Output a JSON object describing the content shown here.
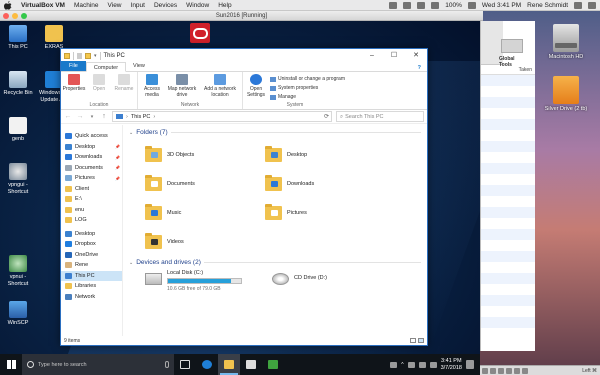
{
  "mac_menubar": {
    "app": "VirtualBox VM",
    "items": [
      "Machine",
      "View",
      "Input",
      "Devices",
      "Window",
      "Help"
    ],
    "battery": "100%",
    "clock": "Wed 3:41 PM",
    "user": "Rene Schmidt"
  },
  "vbox": {
    "window_title": "Sun2016 [Running]",
    "hostkey": "Left ⌘"
  },
  "mac_icons": [
    "Macintosh HD",
    "Silver Drive (2 tb)"
  ],
  "finder": {
    "toolbar_label": "Global Tools",
    "column_header": "Taken"
  },
  "desktop_icons": [
    "This PC",
    "EXRAS",
    "Recycle Bin",
    "Windows 10 Update A...",
    "genb",
    "vpngui - Shortcut",
    "vpnui - Shortcut",
    "WinSCP"
  ],
  "explorer": {
    "title": "This PC",
    "tabs": {
      "file": "File",
      "computer": "Computer",
      "view": "View"
    },
    "ribbon": {
      "location": {
        "label": "Location",
        "buttons": [
          "Properties",
          "Open",
          "Rename"
        ]
      },
      "network": {
        "label": "Network",
        "buttons": [
          "Access media",
          "Map network drive",
          "Add a network location"
        ]
      },
      "system": {
        "label": "System",
        "open_settings": "Open Settings",
        "links": [
          "Uninstall or change a program",
          "System properties",
          "Manage"
        ]
      }
    },
    "address": {
      "path": "This PC",
      "search_placeholder": "Search This PC"
    },
    "nav": [
      {
        "label": "Quick access",
        "color": "#2b78d8"
      },
      {
        "label": "Desktop",
        "color": "#3b82d0",
        "pin": true
      },
      {
        "label": "Downloads",
        "color": "#2b78d8",
        "pin": true
      },
      {
        "label": "Documents",
        "color": "#9aa7b5",
        "pin": true
      },
      {
        "label": "Pictures",
        "color": "#7aa8d4",
        "pin": true
      },
      {
        "label": "Client",
        "color": "#f0c24e"
      },
      {
        "label": "E:\\",
        "color": "#f0c24e"
      },
      {
        "label": "enu",
        "color": "#f0c24e"
      },
      {
        "label": "LOG",
        "color": "#f0c24e"
      },
      {
        "label": "Desktop",
        "color": "#3b82d0",
        "sp": true
      },
      {
        "label": "Dropbox",
        "color": "#1f7ee0"
      },
      {
        "label": "OneDrive",
        "color": "#2566b8"
      },
      {
        "label": "Rene",
        "color": "#d9b37d"
      },
      {
        "label": "This PC",
        "color": "#3c7fcf",
        "selected": true
      },
      {
        "label": "Libraries",
        "color": "#f0c24e"
      },
      {
        "label": "Network",
        "color": "#4a7fbd"
      }
    ],
    "folders_header": "Folders (7)",
    "folders": [
      {
        "label": "3D Objects",
        "color": "#6fa9e0"
      },
      {
        "label": "Desktop",
        "color": "#3b82d0"
      },
      {
        "label": "Documents",
        "color": "#ffffff"
      },
      {
        "label": "Downloads",
        "color": "#2b78d8"
      },
      {
        "label": "Music",
        "color": "#2b78d8"
      },
      {
        "label": "Pictures",
        "color": "#ffffff"
      },
      {
        "label": "Videos",
        "color": "#333333"
      }
    ],
    "drives_header": "Devices and drives (2)",
    "drives": [
      {
        "label": "Local Disk (C:)",
        "free": "10.6 GB free of 79.0 GB",
        "used_fraction": 0.866
      },
      {
        "label": "CD Drive (D:)"
      }
    ],
    "status": "9 items"
  },
  "taskbar": {
    "search_placeholder": "Type here to search",
    "time": "3:41 PM",
    "date": "3/7/2018"
  }
}
